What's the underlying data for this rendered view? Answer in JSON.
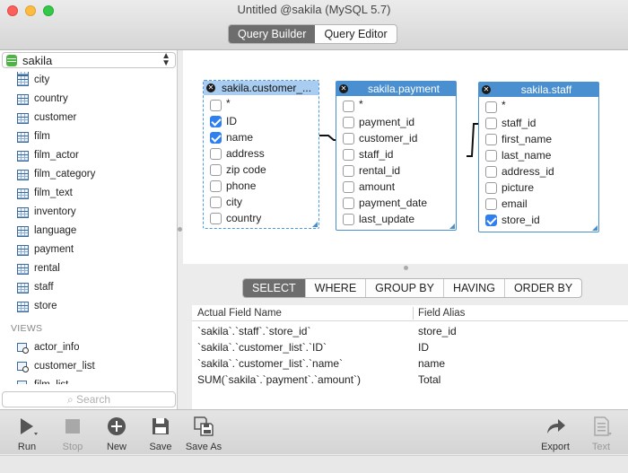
{
  "window": {
    "title": "Untitled @sakila (MySQL 5.7)",
    "mode_tabs": [
      {
        "label": "Query Builder",
        "active": true
      },
      {
        "label": "Query Editor",
        "active": false
      }
    ]
  },
  "sidebar": {
    "database": "sakila",
    "tables": [
      "city",
      "country",
      "customer",
      "film",
      "film_actor",
      "film_category",
      "film_text",
      "inventory",
      "language",
      "payment",
      "rental",
      "staff",
      "store"
    ],
    "views_label": "VIEWS",
    "views": [
      "actor_info",
      "customer_list",
      "film_list"
    ],
    "search_placeholder": "Search"
  },
  "canvas": {
    "tables": [
      {
        "name": "sakila.customer_...",
        "selected": true,
        "fields": [
          {
            "label": "*",
            "checked": false
          },
          {
            "label": "ID",
            "checked": true
          },
          {
            "label": "name",
            "checked": true
          },
          {
            "label": "address",
            "checked": false
          },
          {
            "label": "zip code",
            "checked": false
          },
          {
            "label": "phone",
            "checked": false
          },
          {
            "label": "city",
            "checked": false
          },
          {
            "label": "country",
            "checked": false
          }
        ]
      },
      {
        "name": "sakila.payment",
        "selected": false,
        "fields": [
          {
            "label": "*",
            "checked": false
          },
          {
            "label": "payment_id",
            "checked": false
          },
          {
            "label": "customer_id",
            "checked": false
          },
          {
            "label": "staff_id",
            "checked": false
          },
          {
            "label": "rental_id",
            "checked": false
          },
          {
            "label": "amount",
            "checked": false
          },
          {
            "label": "payment_date",
            "checked": false
          },
          {
            "label": "last_update",
            "checked": false
          }
        ]
      },
      {
        "name": "sakila.staff",
        "selected": false,
        "fields": [
          {
            "label": "*",
            "checked": false
          },
          {
            "label": "staff_id",
            "checked": false
          },
          {
            "label": "first_name",
            "checked": false
          },
          {
            "label": "last_name",
            "checked": false
          },
          {
            "label": "address_id",
            "checked": false
          },
          {
            "label": "picture",
            "checked": false
          },
          {
            "label": "email",
            "checked": false
          },
          {
            "label": "store_id",
            "checked": true
          }
        ]
      }
    ]
  },
  "clauses": [
    {
      "label": "SELECT",
      "active": true
    },
    {
      "label": "WHERE",
      "active": false
    },
    {
      "label": "GROUP BY",
      "active": false
    },
    {
      "label": "HAVING",
      "active": false
    },
    {
      "label": "ORDER BY",
      "active": false
    }
  ],
  "fields_table": {
    "headers": [
      "Actual Field Name",
      "Field Alias"
    ],
    "rows": [
      [
        "`sakila`.`staff`.`store_id`",
        "store_id"
      ],
      [
        "`sakila`.`customer_list`.`ID`",
        "ID"
      ],
      [
        "`sakila`.`customer_list`.`name`",
        "name"
      ],
      [
        "SUM(`sakila`.`payment`.`amount`)",
        "Total"
      ]
    ]
  },
  "toolbar": {
    "run": "Run",
    "stop": "Stop",
    "new": "New",
    "save": "Save",
    "save_as": "Save As",
    "export": "Export",
    "text": "Text"
  }
}
